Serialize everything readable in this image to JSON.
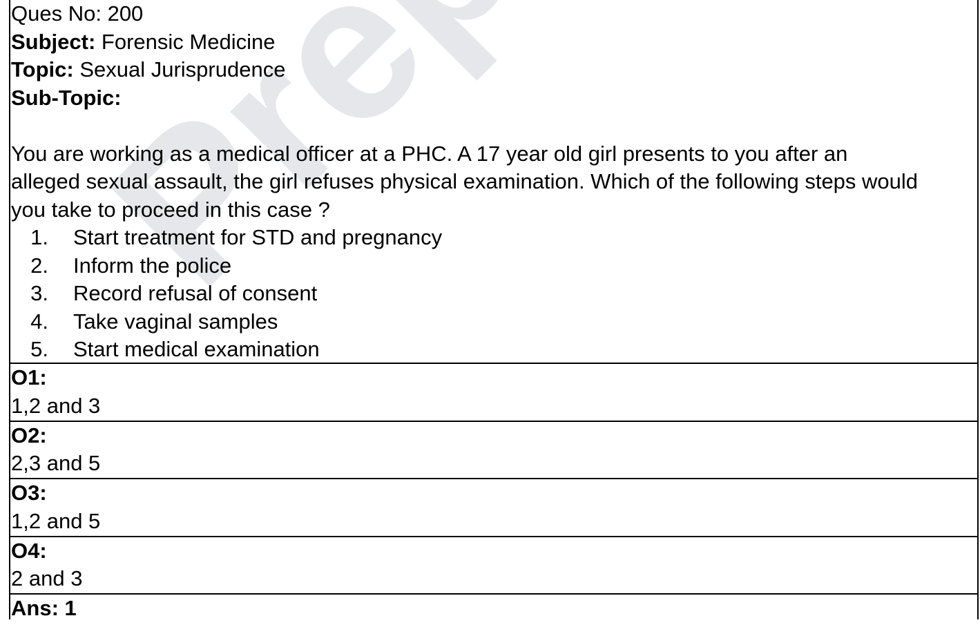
{
  "header": {
    "ques_no_label": "Ques No:",
    "ques_no_value": "200",
    "subject_label": "Subject:",
    "subject_value": "Forensic Medicine",
    "topic_label": "Topic:",
    "topic_value": "Sexual Jurisprudence",
    "subtopic_label": "Sub-Topic:",
    "subtopic_value": ""
  },
  "question": {
    "stem_lines": [
      "You are working as a medical officer at a PHC. A 17 year old girl presents to you after an",
      "alleged sexual assault, the girl refuses physical examination. Which of the following steps would",
      "you take to proceed in this case ?"
    ],
    "steps": [
      {
        "num": "1.",
        "text": "Start treatment for STD and pregnancy"
      },
      {
        "num": "2.",
        "text": "Inform the police"
      },
      {
        "num": "3.",
        "text": "Record refusal of consent"
      },
      {
        "num": "4.",
        "text": "Take vaginal samples"
      },
      {
        "num": "5.",
        "text": "Start medical examination"
      }
    ]
  },
  "options": [
    {
      "label": "O1:",
      "text": "1,2 and 3"
    },
    {
      "label": "O2:",
      "text": "2,3 and 5"
    },
    {
      "label": "O3:",
      "text": "1,2 and 5"
    },
    {
      "label": "O4:",
      "text": "2 and 3"
    }
  ],
  "answer": {
    "label": "Ans: 1"
  },
  "watermark": {
    "text": "PrepLa"
  }
}
